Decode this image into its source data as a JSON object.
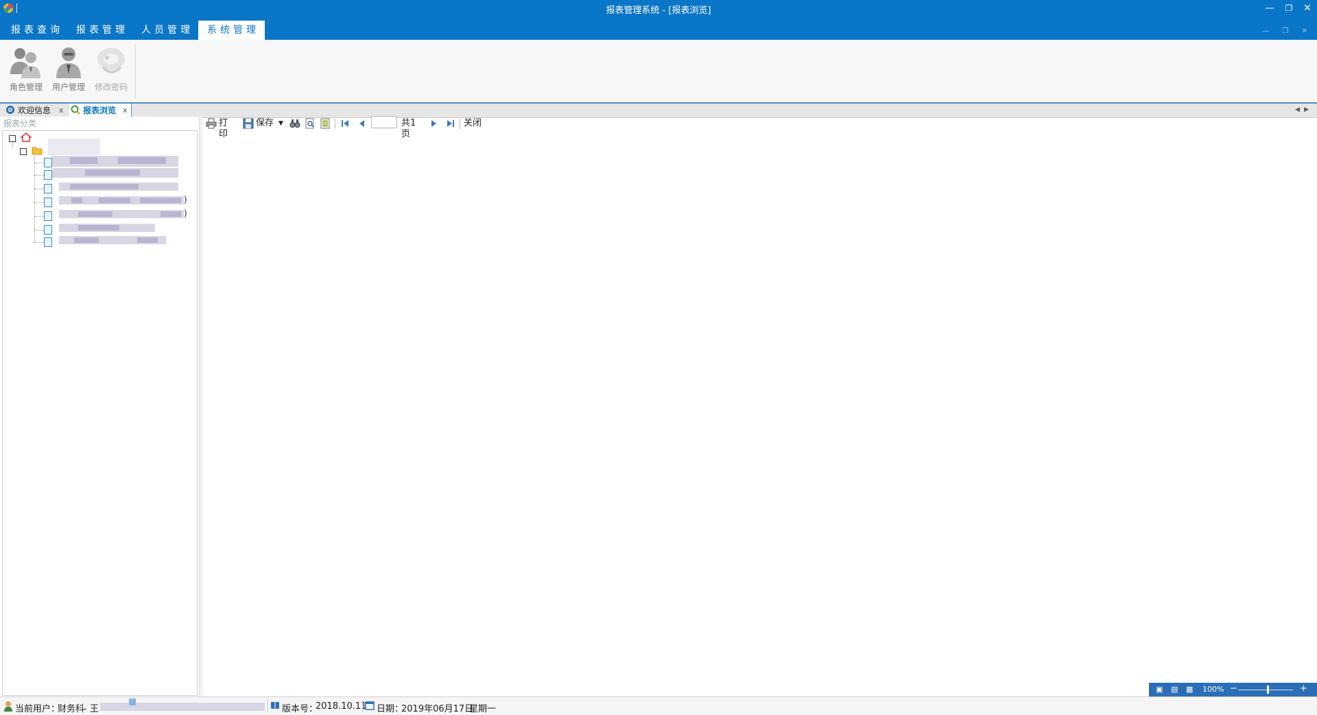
{
  "window": {
    "title": "报表管理系统 - [报表浏览]",
    "accent_color": "#0a76c8",
    "controls": [
      "minimize-icon",
      "restore-icon",
      "close-icon"
    ]
  },
  "ribbon": {
    "tabs": [
      {
        "label": "报表查询",
        "active": false
      },
      {
        "label": "报表管理",
        "active": false
      },
      {
        "label": "人员管理",
        "active": false
      },
      {
        "label": "系统管理",
        "active": true
      }
    ],
    "buttons": [
      {
        "label": "角色管理",
        "icon": "role-users-icon",
        "enabled": true
      },
      {
        "label": "用户管理",
        "icon": "user-icon",
        "enabled": true
      },
      {
        "label": "修改密码",
        "icon": "change-password-icon",
        "enabled": false
      }
    ]
  },
  "doc_tabs": [
    {
      "label": "欢迎信息",
      "icon": "welcome-icon",
      "active": false,
      "close": "x"
    },
    {
      "label": "报表浏览",
      "icon": "report-browse-icon",
      "active": true,
      "close": "x"
    }
  ],
  "left_panel": {
    "title": "报表分类",
    "tree": {
      "root_icon": "home-icon",
      "folder_icon": "folder-icon",
      "items": [
        {
          "icon": "report-doc-icon",
          "suffix": ""
        },
        {
          "icon": "report-doc-icon",
          "suffix": ""
        },
        {
          "icon": "report-doc-icon",
          "suffix": ""
        },
        {
          "icon": "report-doc-icon",
          "suffix": ")"
        },
        {
          "icon": "report-doc-icon",
          "suffix": ")"
        },
        {
          "icon": "report-doc-icon",
          "suffix": ""
        },
        {
          "icon": "report-doc-icon",
          "suffix": ""
        }
      ]
    }
  },
  "report_toolbar": {
    "print": "打印",
    "save": "保存",
    "page_input_value": "",
    "total_pages": "共1页",
    "close": "关闭"
  },
  "zoom": {
    "label": "100%",
    "minus": "−",
    "plus": "+"
  },
  "status": {
    "user_label": "当前用户：",
    "department": "财务科",
    "user_prefix": "- 王",
    "version_label": "版本号：",
    "version": "2018.10.11",
    "date_label": "日期：",
    "date": "2019年06月17日",
    "weekday": "星期一"
  }
}
